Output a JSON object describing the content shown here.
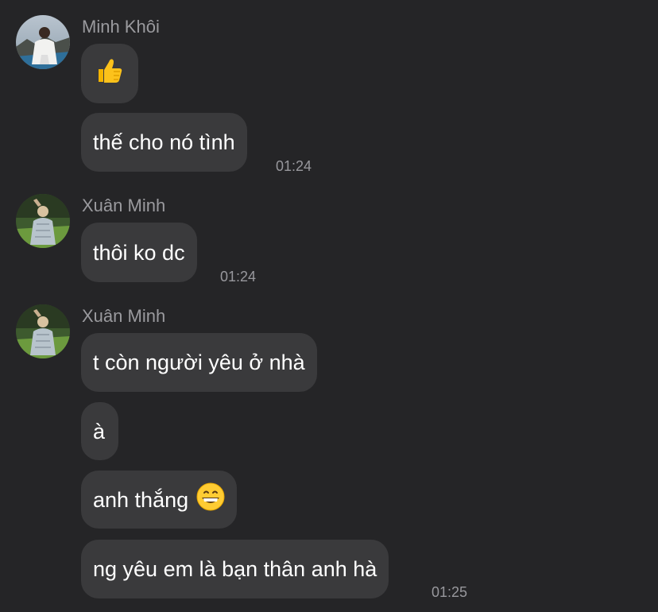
{
  "groups": [
    {
      "sender": "Minh Khôi",
      "avatar": "avatar-minh-khoi",
      "messages": [
        {
          "text": "",
          "emoji": "thumbs-up-emoji"
        },
        {
          "text": "thế cho nó tình",
          "time": "01:24"
        }
      ]
    },
    {
      "sender": "Xuân Minh",
      "avatar": "avatar-xuan-minh",
      "messages": [
        {
          "text": "thôi ko dc",
          "time": "01:24"
        }
      ]
    },
    {
      "sender": "Xuân Minh",
      "avatar": "avatar-xuan-minh",
      "messages": [
        {
          "text": "t còn người yêu ở nhà"
        },
        {
          "text": "à"
        },
        {
          "text": "anh thắng",
          "emoji": "grinning-face-emoji"
        },
        {
          "text": "ng yêu em là bạn thân anh hà",
          "time": "01:25"
        }
      ]
    }
  ],
  "colors": {
    "background": "#252527",
    "bubble": "#3a3a3c",
    "sender_name": "#9a9a9e",
    "timestamp": "#98989d",
    "text": "#ffffff"
  }
}
